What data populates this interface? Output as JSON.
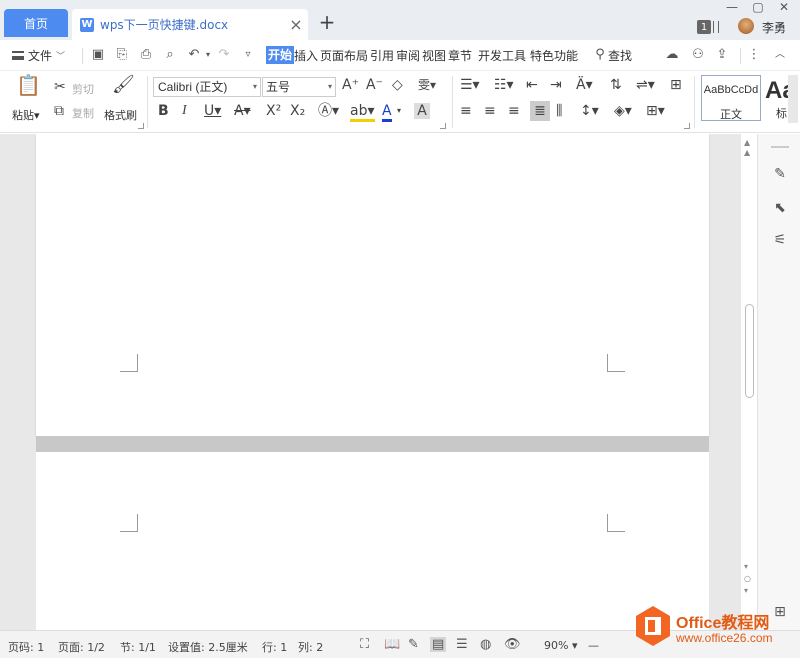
{
  "tabbar": {
    "home_tab": "首页",
    "doc_tab": "wps下一页快捷键.docx",
    "doc_icon": "W",
    "close_glyph": "×",
    "add_glyph": "+",
    "window_min": "—",
    "window_max": "▢",
    "window_close": "✕",
    "badge_count": "1",
    "user_name": "李勇"
  },
  "menu": {
    "file": "文件",
    "tabs": [
      "开始",
      "插入",
      "页面布局",
      "引用",
      "审阅",
      "视图",
      "章节",
      "开发工具",
      "特色功能"
    ],
    "search": "查找"
  },
  "ribbon": {
    "paste": "粘贴",
    "cut": "剪切",
    "copy": "复制",
    "format_painter": "格式刷",
    "font_name": "Calibri (正文)",
    "font_size": "五号",
    "style_preview": "AaBbCcDd",
    "style_name": "正文",
    "style2_preview": "Aa",
    "style2_name": "标"
  },
  "statusbar": {
    "page_num": "页码: 1",
    "pages": "页面: 1/2",
    "section": "节: 1/1",
    "setting": "设置值: 2.5厘米",
    "row": "行: 1",
    "col": "列: 2",
    "zoom": "90%"
  },
  "watermark": {
    "brand": "Office教程网",
    "url": "www.office26.com"
  }
}
